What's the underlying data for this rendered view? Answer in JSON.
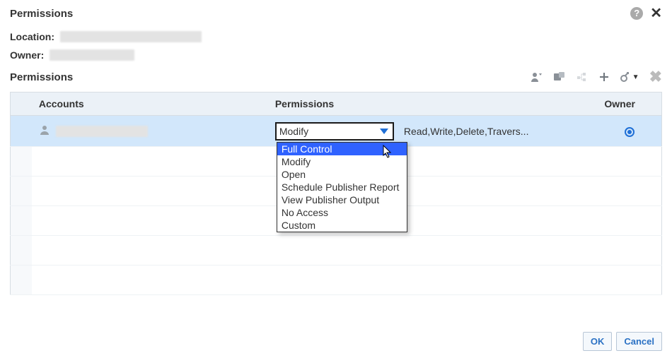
{
  "dialog": {
    "title": "Permissions",
    "location_label": "Location:",
    "owner_label": "Owner:",
    "section_label": "Permissions"
  },
  "toolbar": {
    "icons": [
      "add-user-icon",
      "add-group-icon",
      "set-hierarchy-icon",
      "add-icon",
      "inherit-icon",
      "dropdown-icon",
      "delete-icon"
    ]
  },
  "columns": {
    "accounts": "Accounts",
    "permissions": "Permissions",
    "owner": "Owner"
  },
  "rows": [
    {
      "account_redacted": true,
      "permission_selected": "Modify",
      "permission_desc": "Read,Write,Delete,Travers...",
      "owner_selected": true
    }
  ],
  "dropdown": {
    "hover_index": 0,
    "options": [
      "Full Control",
      "Modify",
      "Open",
      "Schedule Publisher Report",
      "View Publisher Output",
      "No Access",
      "Custom"
    ]
  },
  "buttons": {
    "ok": "OK",
    "cancel": "Cancel"
  }
}
